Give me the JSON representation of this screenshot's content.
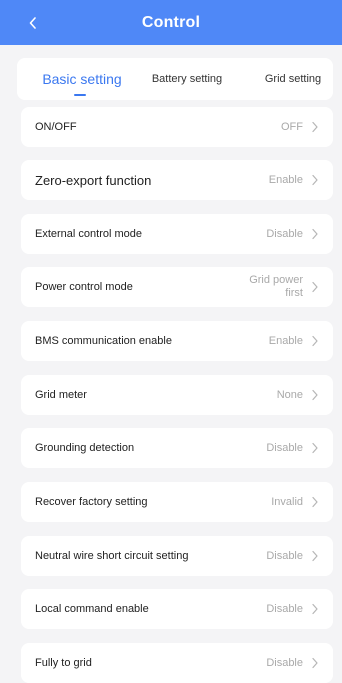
{
  "header": {
    "title": "Control"
  },
  "tabs": [
    {
      "label": "Basic setting"
    },
    {
      "label": "Battery setting"
    },
    {
      "label": "Grid setting"
    }
  ],
  "settings": [
    {
      "label": "ON/OFF",
      "value": "OFF"
    },
    {
      "label": "Zero-export function",
      "value": "Enable"
    },
    {
      "label": "External control mode",
      "value": "Disable"
    },
    {
      "label": "Power control mode",
      "value_line1": "Grid power",
      "value_line2": "first"
    },
    {
      "label": "BMS communication enable",
      "value": "Enable"
    },
    {
      "label": "Grid meter",
      "value": "None"
    },
    {
      "label": "Grounding detection",
      "value": "Disable"
    },
    {
      "label": "Recover factory setting",
      "value": "Invalid"
    },
    {
      "label": "Neutral wire short circuit setting",
      "value": "Disable"
    },
    {
      "label": "Local command enable",
      "value": "Disable"
    },
    {
      "label": "Fully to grid",
      "value": "Disable"
    }
  ],
  "colors": {
    "primary": "#4f88f7",
    "active_tab": "#3b78f0",
    "background": "#f4f4f6",
    "value_text": "#a9a9a9"
  },
  "icons": {
    "back": "chevron-left-icon",
    "row_arrow": "chevron-right-icon"
  }
}
